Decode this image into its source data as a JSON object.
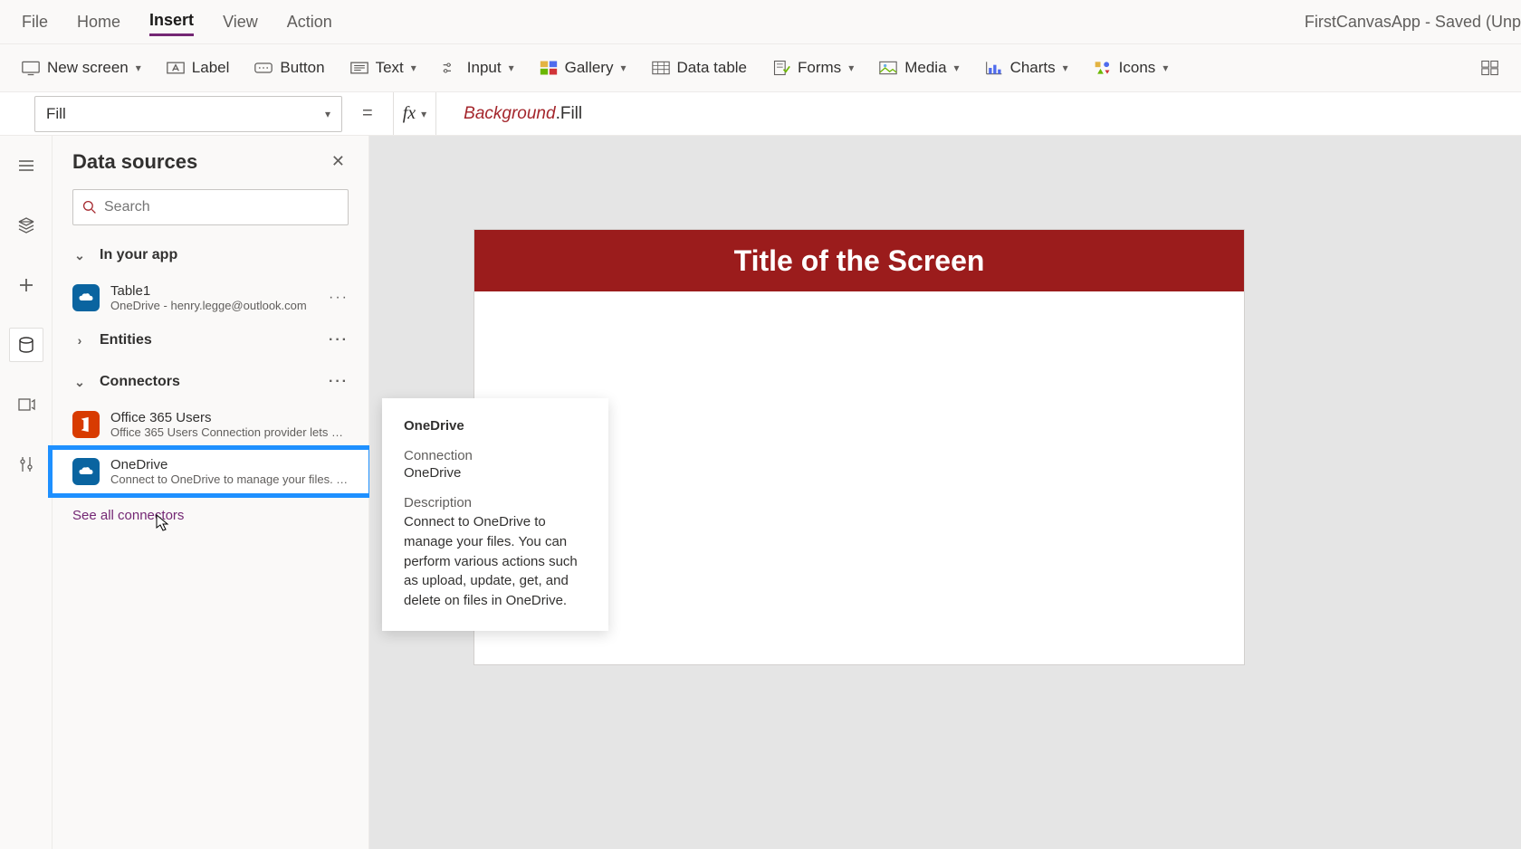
{
  "menubar": {
    "items": [
      "File",
      "Home",
      "Insert",
      "View",
      "Action"
    ],
    "active_index": 2,
    "app_title": "FirstCanvasApp - Saved (Unp"
  },
  "ribbon": {
    "new_screen": "New screen",
    "label": "Label",
    "button": "Button",
    "text": "Text",
    "input": "Input",
    "gallery": "Gallery",
    "data_table": "Data table",
    "forms": "Forms",
    "media": "Media",
    "charts": "Charts",
    "icons": "Icons"
  },
  "formulabar": {
    "property": "Fill",
    "fx": "fx",
    "formula_token1": "Background",
    "formula_token2": ".Fill"
  },
  "panel": {
    "title": "Data sources",
    "search_placeholder": "Search",
    "sections": {
      "in_your_app": "In your app",
      "entities": "Entities",
      "connectors": "Connectors"
    },
    "in_app_items": [
      {
        "name": "Table1",
        "sub": "OneDrive - henry.legge@outlook.com"
      }
    ],
    "connector_items": [
      {
        "name": "Office 365 Users",
        "sub": "Office 365 Users Connection provider lets you ..."
      },
      {
        "name": "OneDrive",
        "sub": "Connect to OneDrive to manage your files. Yo..."
      }
    ],
    "see_all": "See all connectors"
  },
  "tooltip": {
    "title": "OneDrive",
    "connection_label": "Connection",
    "connection_value": "OneDrive",
    "description_label": "Description",
    "description_value": "Connect to OneDrive to manage your files. You can perform various actions such as upload, update, get, and delete on files in OneDrive."
  },
  "canvas": {
    "title_band": "Title of the Screen"
  }
}
